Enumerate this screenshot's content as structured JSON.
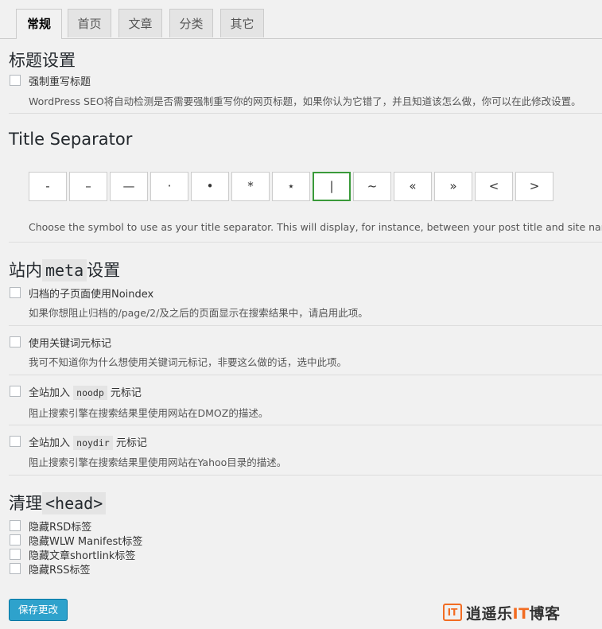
{
  "tabs": [
    {
      "label": "常规",
      "active": true
    },
    {
      "label": "首页"
    },
    {
      "label": "文章"
    },
    {
      "label": "分类"
    },
    {
      "label": "其它"
    }
  ],
  "title_settings": {
    "heading": "标题设置",
    "force_rewrite": {
      "label": "强制重写标题",
      "checked": false,
      "description": "WordPress SEO将自动检测是否需要强制重写你的网页标题，如果你认为它错了，并且知道该怎么做，你可以在此修改设置。"
    }
  },
  "separator": {
    "heading": "Title Separator",
    "options": [
      "-",
      "–",
      "—",
      "·",
      "•",
      "*",
      "⋆",
      "|",
      "~",
      "«",
      "»",
      "<",
      ">"
    ],
    "selected": "|",
    "description": "Choose the symbol to use as your title separator. This will display, for instance, between your post title and site name. Sym"
  },
  "meta": {
    "heading_pre": "站内",
    "heading_code": "meta",
    "heading_post": "设置",
    "noindex": {
      "label": "归档的子页面使用Noindex",
      "checked": false,
      "description": "如果你想阻止归档的/page/2/及之后的页面显示在搜索结果中，请启用此项。"
    },
    "keywords": {
      "label": "使用关键词元标记",
      "checked": false,
      "description": "我可不知道你为什么想使用关键词元标记，非要这么做的话，选中此项。"
    },
    "noodp": {
      "label_pre": "全站加入",
      "code": "noodp",
      "label_post": "元标记",
      "checked": false,
      "description": "阻止搜索引擎在搜索结果里使用网站在DMOZ的描述。"
    },
    "noydir": {
      "label_pre": "全站加入",
      "code": "noydir",
      "label_post": "元标记",
      "checked": false,
      "description": "阻止搜索引擎在搜索结果里使用网站在Yahoo目录的描述。"
    }
  },
  "head_cleanup": {
    "heading_pre": "清理",
    "heading_code": "<head>",
    "items": [
      {
        "label": "隐藏RSD标签",
        "checked": false
      },
      {
        "label": "隐藏WLW Manifest标签",
        "checked": false
      },
      {
        "label": "隐藏文章shortlink标签",
        "checked": false
      },
      {
        "label": "隐藏RSS标签",
        "checked": false
      }
    ]
  },
  "save_label": "保存更改",
  "watermark": {
    "badge": "IT",
    "text_pre": "逍遥乐",
    "text_it": "IT",
    "text_post": "博客"
  },
  "colors": {
    "accent": "#2ea2cc",
    "selected_border": "#3a9a3a",
    "watermark": "#f26c22"
  }
}
